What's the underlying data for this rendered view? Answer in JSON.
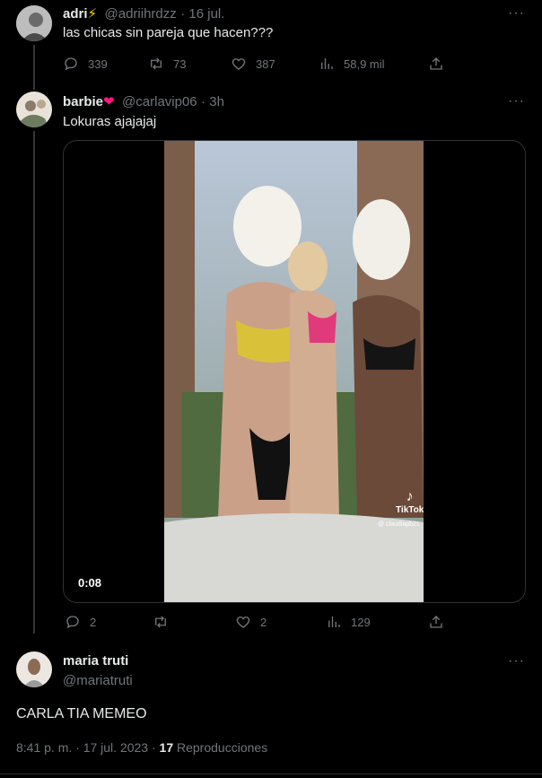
{
  "tweet1": {
    "name": "adri",
    "emoji": "⚡",
    "handle": "@adriihrdzz",
    "date": "· 16 jul.",
    "text": "las chicas sin pareja que hacen???",
    "replies": "339",
    "retweets": "73",
    "likes": "387",
    "views": "58,9 mil"
  },
  "tweet2": {
    "name": "barbie",
    "emoji": "❤",
    "handle": "@carlavip06",
    "date": "· 3h",
    "text": "Lokuras ajajajaj",
    "video_duration": "0:08",
    "tiktok_label": "TikTok",
    "tiktok_handle": "@ claudiapb21",
    "replies": "2",
    "likes": "2",
    "views": "129"
  },
  "tweet3": {
    "name": "maria truti",
    "handle": "@mariatruti",
    "text": "CARLA TIA MEMEO",
    "timestamp": "8:41 p. m. · 17 jul. 2023 ·",
    "views_count": "17",
    "views_label": "Reproducciones"
  },
  "more_label": "···",
  "colors": {
    "background": "#000000",
    "text": "#e7e9ea",
    "muted": "#71767b",
    "heart": "#f91880",
    "bolt": "#ffd400"
  }
}
